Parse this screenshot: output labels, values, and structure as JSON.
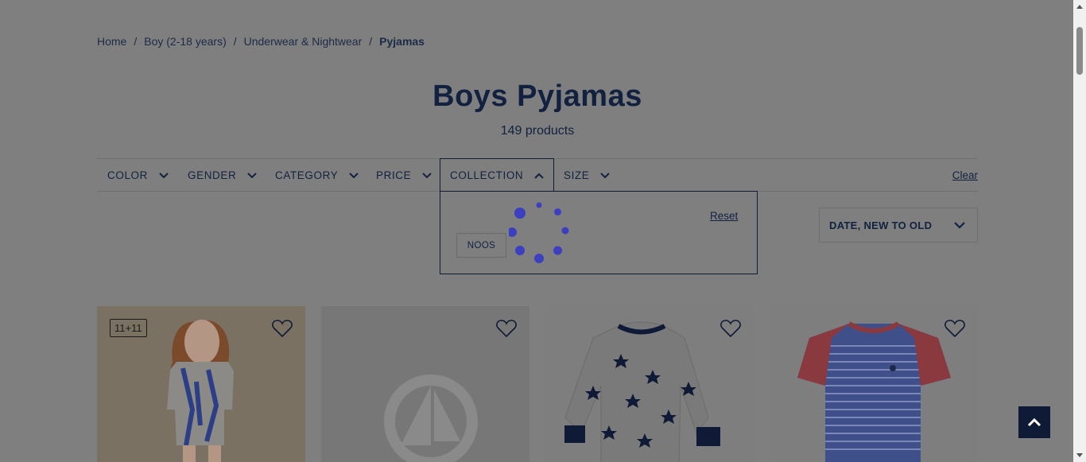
{
  "breadcrumb": {
    "items": [
      "Home",
      "Boy (2-18 years)",
      "Underwear & Nightwear"
    ],
    "current": "Pyjamas",
    "separator": "/"
  },
  "page": {
    "title": "Boys Pyjamas",
    "count": "149 products"
  },
  "filters": {
    "items": [
      "COLOR",
      "GENDER",
      "CATEGORY",
      "PRICE",
      "COLLECTION",
      "SIZE"
    ],
    "active": "COLLECTION",
    "clear_label": "Clear"
  },
  "dropdown": {
    "reset_label": "Reset",
    "options": [
      "NOOS"
    ]
  },
  "sort": {
    "label": "DATE, NEW TO OLD"
  },
  "products": [
    {
      "badge": "11+11",
      "image": "girl-eiffel-pyjamas"
    },
    {
      "badge": "",
      "image": "placeholder-logo"
    },
    {
      "badge": "",
      "image": "star-print-pyjamas"
    },
    {
      "badge": "",
      "image": "striped-tshirt"
    }
  ],
  "colors": {
    "overlay": "#7f7f7f",
    "navy": "#0e1a36",
    "spinner": "#3c3fbf"
  }
}
